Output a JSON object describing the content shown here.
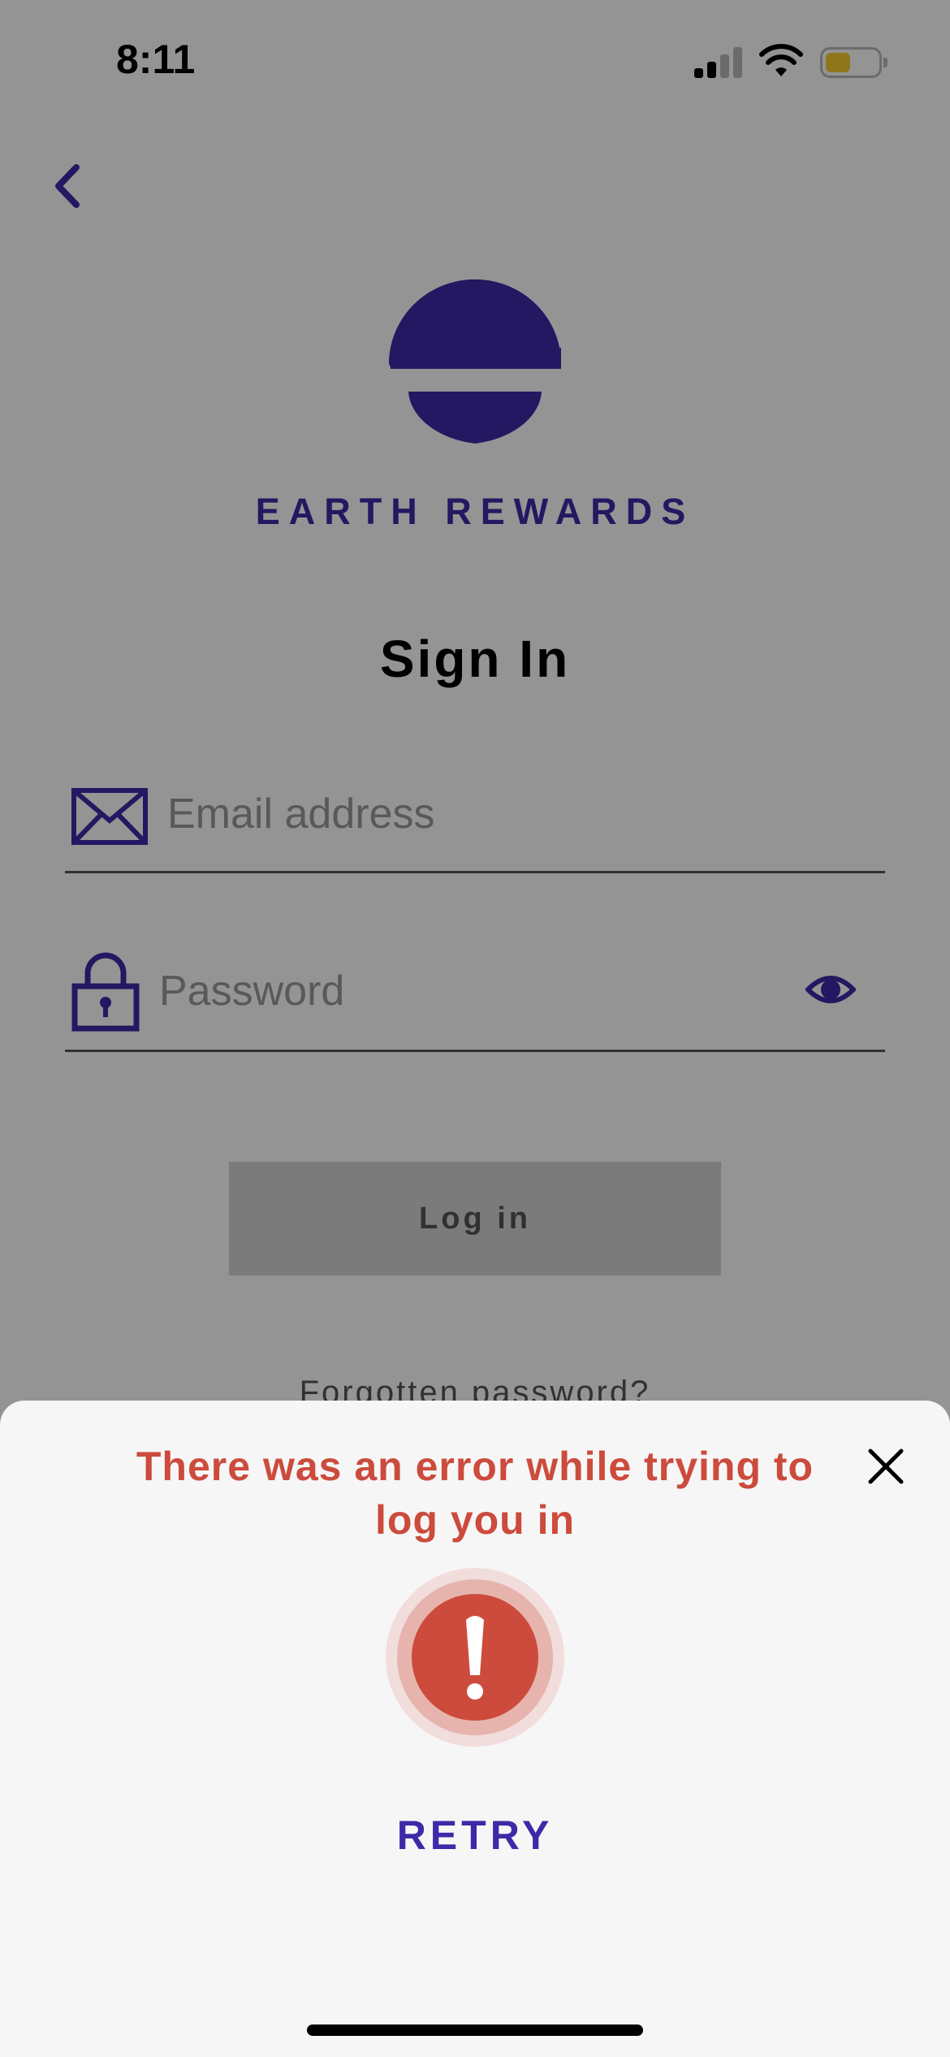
{
  "status_bar": {
    "time": "8:11"
  },
  "brand": {
    "name": "EARTH REWARDS"
  },
  "page": {
    "title": "Sign In"
  },
  "form": {
    "email_placeholder": "Email address",
    "password_placeholder": "Password",
    "login_label": "Log in",
    "forgot_label": "Forgotten password?"
  },
  "error_sheet": {
    "message": "There was an error while trying to log you in",
    "retry_label": "RETRY"
  },
  "icons": {
    "back": "chevron-left-icon",
    "email": "envelope-icon",
    "password": "lock-icon",
    "show_password": "eye-icon",
    "close": "close-icon",
    "alert": "exclamation-icon"
  },
  "colors": {
    "brand": "#3d2aa8",
    "error": "#cc4b3c",
    "battery": "#f3cd2e"
  }
}
